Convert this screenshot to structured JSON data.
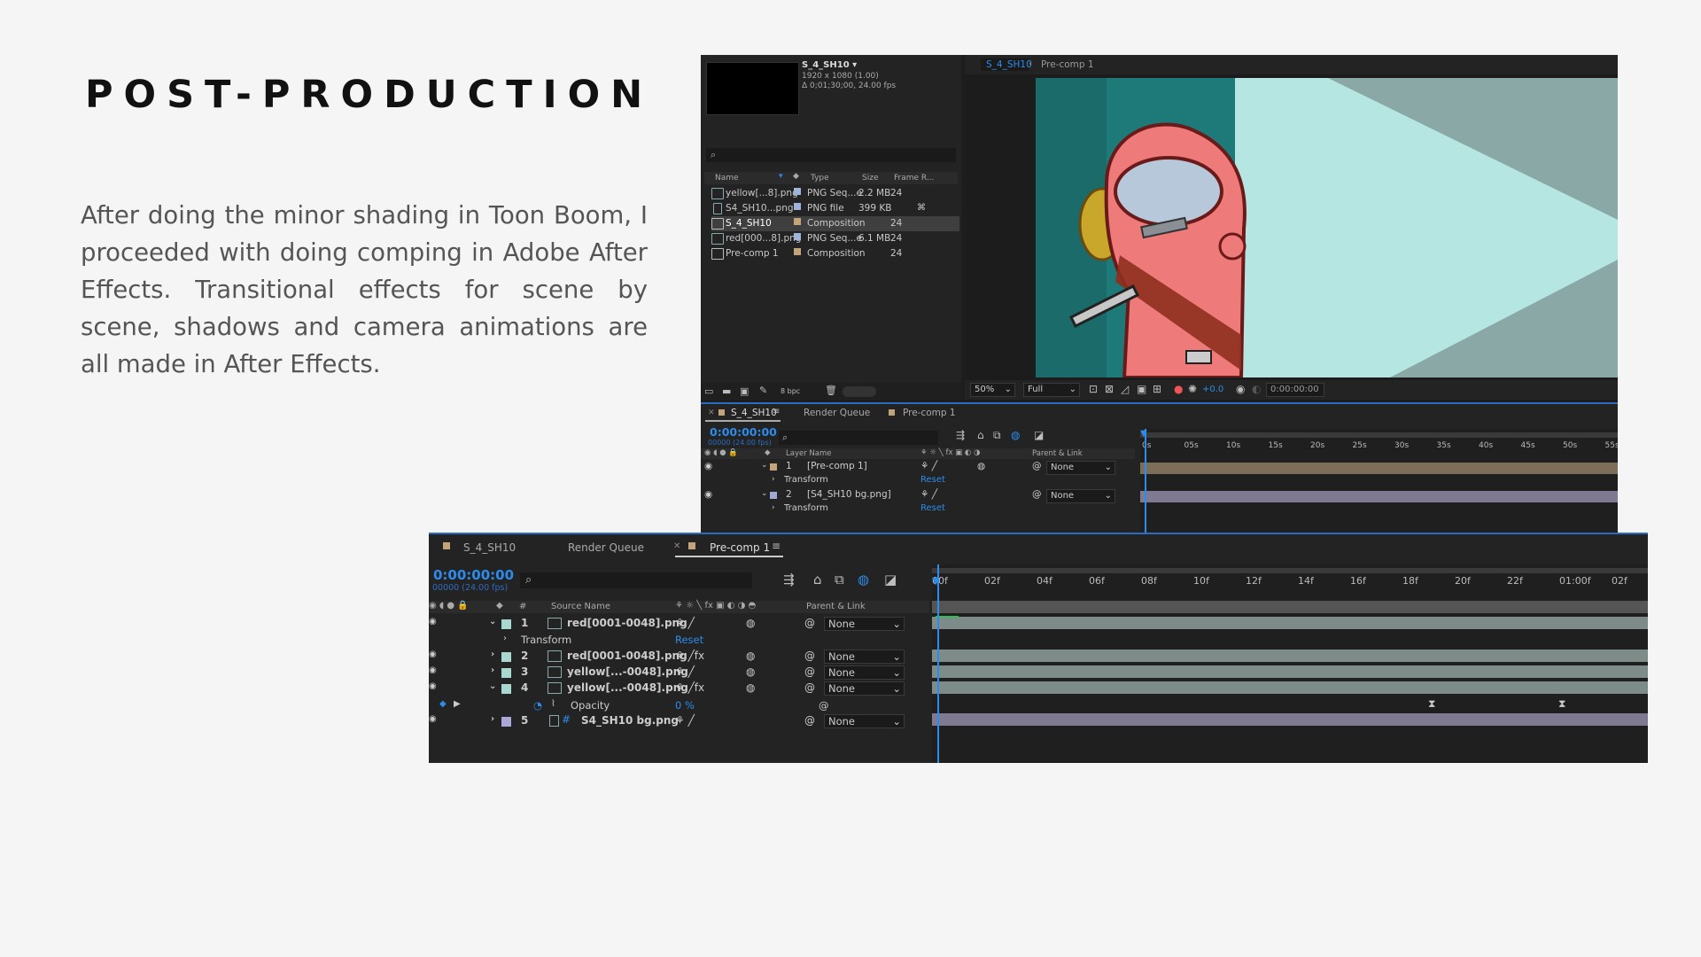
{
  "slide": {
    "title": "POST-PRODUCTION",
    "body": "After doing the minor shading in Toon Boom, I proceeded with doing comping in Adobe After Effects. Transitional effects for scene by scene, shadows and camera animations are all made in After Effects."
  },
  "top_panel": {
    "project": {
      "comp_name": "S_4_SH10 ▾",
      "comp_res": "1920 x 1080 (1.00)",
      "comp_dur": "Δ 0;01;30;00, 24.00 fps",
      "search_icon": "search-icon",
      "columns": [
        "Name",
        "Type",
        "Size",
        "Frame R..."
      ],
      "items": [
        {
          "name": "yellow[...8].png",
          "type": "PNG Seq...e",
          "size": "2.2 MB",
          "fr": "24",
          "color": "#9fb4d8",
          "selected": false
        },
        {
          "name": "S4_SH10...png",
          "type": "PNG file",
          "size": "399 KB",
          "fr": "",
          "color": "#9fb4d8",
          "selected": false
        },
        {
          "name": "S_4_SH10",
          "type": "Composition",
          "size": "",
          "fr": "24",
          "color": "#c3a47a",
          "selected": true
        },
        {
          "name": "red[000...8].png",
          "type": "PNG Seq...e",
          "size": "6.1 MB",
          "fr": "24",
          "color": "#9fb4d8",
          "selected": false
        },
        {
          "name": "Pre-comp 1",
          "type": "Composition",
          "size": "",
          "fr": "24",
          "color": "#c3a47a",
          "selected": false
        }
      ],
      "bpc": "8 bpc"
    },
    "viewer": {
      "tab_active": "S_4_SH10",
      "tab_other": "Pre-comp 1",
      "zoom": "50%",
      "resolution": "Full",
      "exposure": "+0.0",
      "timecode": "0:00:00:00"
    },
    "timeline": {
      "tabs": [
        "S_4_SH10",
        "Render Queue",
        "Pre-comp 1"
      ],
      "timecode": "0:00:00:00",
      "fps": "00000 (24.00 fps)",
      "col_layer": "Layer Name",
      "col_parent": "Parent & Link",
      "ruler": [
        "0s",
        "05s",
        "10s",
        "15s",
        "20s",
        "25s",
        "30s",
        "35s",
        "40s",
        "45s",
        "50s",
        "55s"
      ],
      "layers": [
        {
          "num": "1",
          "name": "[Pre-comp 1]",
          "parent": "None"
        },
        {
          "num": "2",
          "name": "[S4_SH10 bg.png]",
          "parent": "None"
        }
      ],
      "transform": "Transform",
      "reset": "Reset"
    }
  },
  "bottom_panel": {
    "tabs": [
      "S_4_SH10",
      "Render Queue",
      "Pre-comp 1"
    ],
    "timecode": "0:00:00:00",
    "fps": "00000 (24.00 fps)",
    "col_source": "Source Name",
    "col_parent": "Parent & Link",
    "ruler": [
      "00f",
      "02f",
      "04f",
      "06f",
      "08f",
      "10f",
      "12f",
      "14f",
      "16f",
      "18f",
      "20f",
      "22f",
      "01:00f",
      "02f"
    ],
    "layers": [
      {
        "num": "1",
        "name": "red[0001-0048].png",
        "parent": "None"
      },
      {
        "num": "2",
        "name": "red[0001-0048].png",
        "parent": "None"
      },
      {
        "num": "3",
        "name": "yellow[...-0048].png",
        "parent": "None"
      },
      {
        "num": "4",
        "name": "yellow[...-0048].png",
        "parent": "None"
      },
      {
        "num": "5",
        "name": "S4_SH10 bg.png",
        "parent": "None"
      }
    ],
    "transform": "Transform",
    "reset": "Reset",
    "opacity_label": "Opacity",
    "opacity_value": "0 %"
  }
}
